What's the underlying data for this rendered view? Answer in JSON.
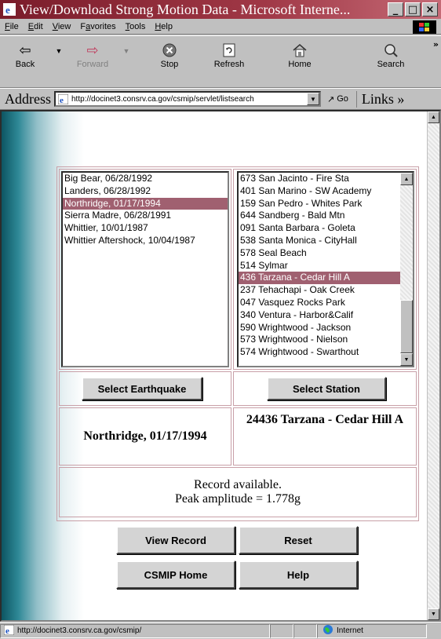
{
  "window": {
    "title": "View/Download Strong Motion Data - Microsoft Interne...",
    "min_icon": "minimize-icon",
    "max_icon": "maximize-icon",
    "close_icon": "close-icon"
  },
  "menu": [
    "File",
    "Edit",
    "View",
    "Favorites",
    "Tools",
    "Help"
  ],
  "menu_underline": [
    "F",
    "E",
    "V",
    "a",
    "T",
    "H"
  ],
  "toolbar": {
    "back": "Back",
    "forward": "Forward",
    "stop": "Stop",
    "refresh": "Refresh",
    "home": "Home",
    "search": "Search",
    "more": "»"
  },
  "address": {
    "label": "Address",
    "url": "http://docinet3.consrv.ca.gov/csmip/servlet/listsearch",
    "go": "Go",
    "links": "Links »"
  },
  "earthquakes": {
    "items": [
      "Big Bear, 06/28/1992",
      "Landers, 06/28/1992",
      "Northridge, 01/17/1994",
      "Sierra Madre, 06/28/1991",
      "Whittier, 10/01/1987",
      "Whittier Aftershock, 10/04/1987"
    ],
    "selected_index": 2,
    "button": "Select Earthquake",
    "selected_label": "Northridge, 01/17/1994"
  },
  "stations": {
    "items": [
      "673 San Jacinto - Fire Sta",
      "401 San Marino - SW Academy",
      "159 San Pedro - Whites Park",
      "644 Sandberg - Bald Mtn",
      "091 Santa Barbara - Goleta",
      "538 Santa Monica - CityHall",
      "578 Seal Beach",
      "514 Sylmar",
      "436 Tarzana - Cedar Hill A",
      "237 Tehachapi - Oak Creek",
      "047 Vasquez Rocks Park",
      "340 Ventura - Harbor&Calif",
      "590 Wrightwood - Jackson",
      "573 Wrightwood - Nielson",
      "574 Wrightwood - Swarthout"
    ],
    "selected_index": 8,
    "button": "Select Station",
    "selected_label": "24436 Tarzana - Cedar Hill A"
  },
  "record": {
    "line1": "Record available.",
    "line2": "Peak amplitude = 1.778g"
  },
  "actions": {
    "view_record": "View Record",
    "reset": "Reset",
    "csmip_home": "CSMIP Home",
    "help": "Help"
  },
  "status": {
    "url": "http://docinet3.consrv.ca.gov/csmip/",
    "zone": "Internet"
  },
  "colors": {
    "title_bar": "#7a1c2a",
    "selection": "#a06070",
    "table_border": "#c8a0a8"
  }
}
